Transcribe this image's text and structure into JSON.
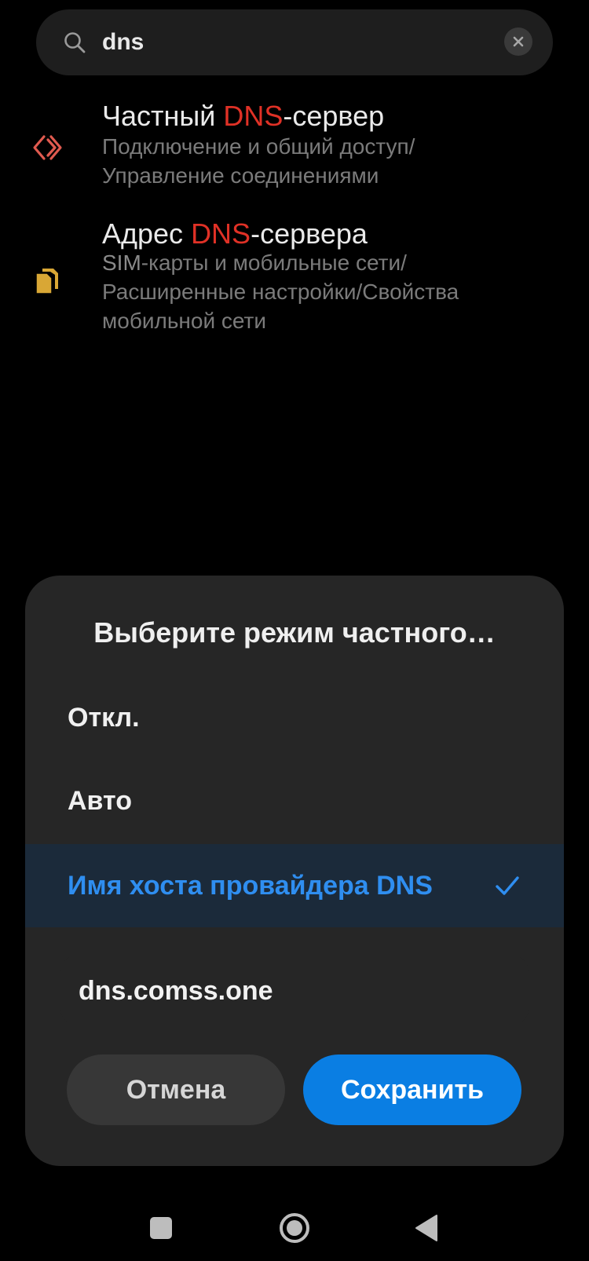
{
  "search": {
    "query": "dns",
    "icon": "search-icon",
    "clear_icon": "clear-icon"
  },
  "results": [
    {
      "title_prefix": "Частный ",
      "title_highlight": "DNS",
      "title_suffix": "-сервер",
      "path_line1": "Подключение и общий доступ/",
      "path_line2": "Управление соединениями",
      "icon": "connection-icon",
      "icon_color": "#e05a4f"
    },
    {
      "title_prefix": "Адрес ",
      "title_highlight": "DNS",
      "title_suffix": "-сервера",
      "path_highlight": "SIM",
      "path_line1": "-карты и мобильные сети/",
      "path_line2": "Расширенные настройки/Свойства",
      "path_line3": "мобильной сети",
      "icon": "sim-cards-icon",
      "icon_color": "#d9a735"
    }
  ],
  "dialog": {
    "title": "Выберите режим частного…",
    "options": [
      {
        "label": "Откл.",
        "selected": false
      },
      {
        "label": "Авто",
        "selected": false
      },
      {
        "label": "Имя хоста провайдера DNS",
        "selected": true
      }
    ],
    "hostname_value": "dns.comss.one",
    "cancel_label": "Отмена",
    "save_label": "Сохранить"
  },
  "colors": {
    "accent": "#0a7ee3",
    "selected_text": "#2f8ef0",
    "highlight": "#e03126"
  },
  "navbar": {
    "items": [
      "recents-icon",
      "home-icon",
      "back-icon"
    ]
  }
}
